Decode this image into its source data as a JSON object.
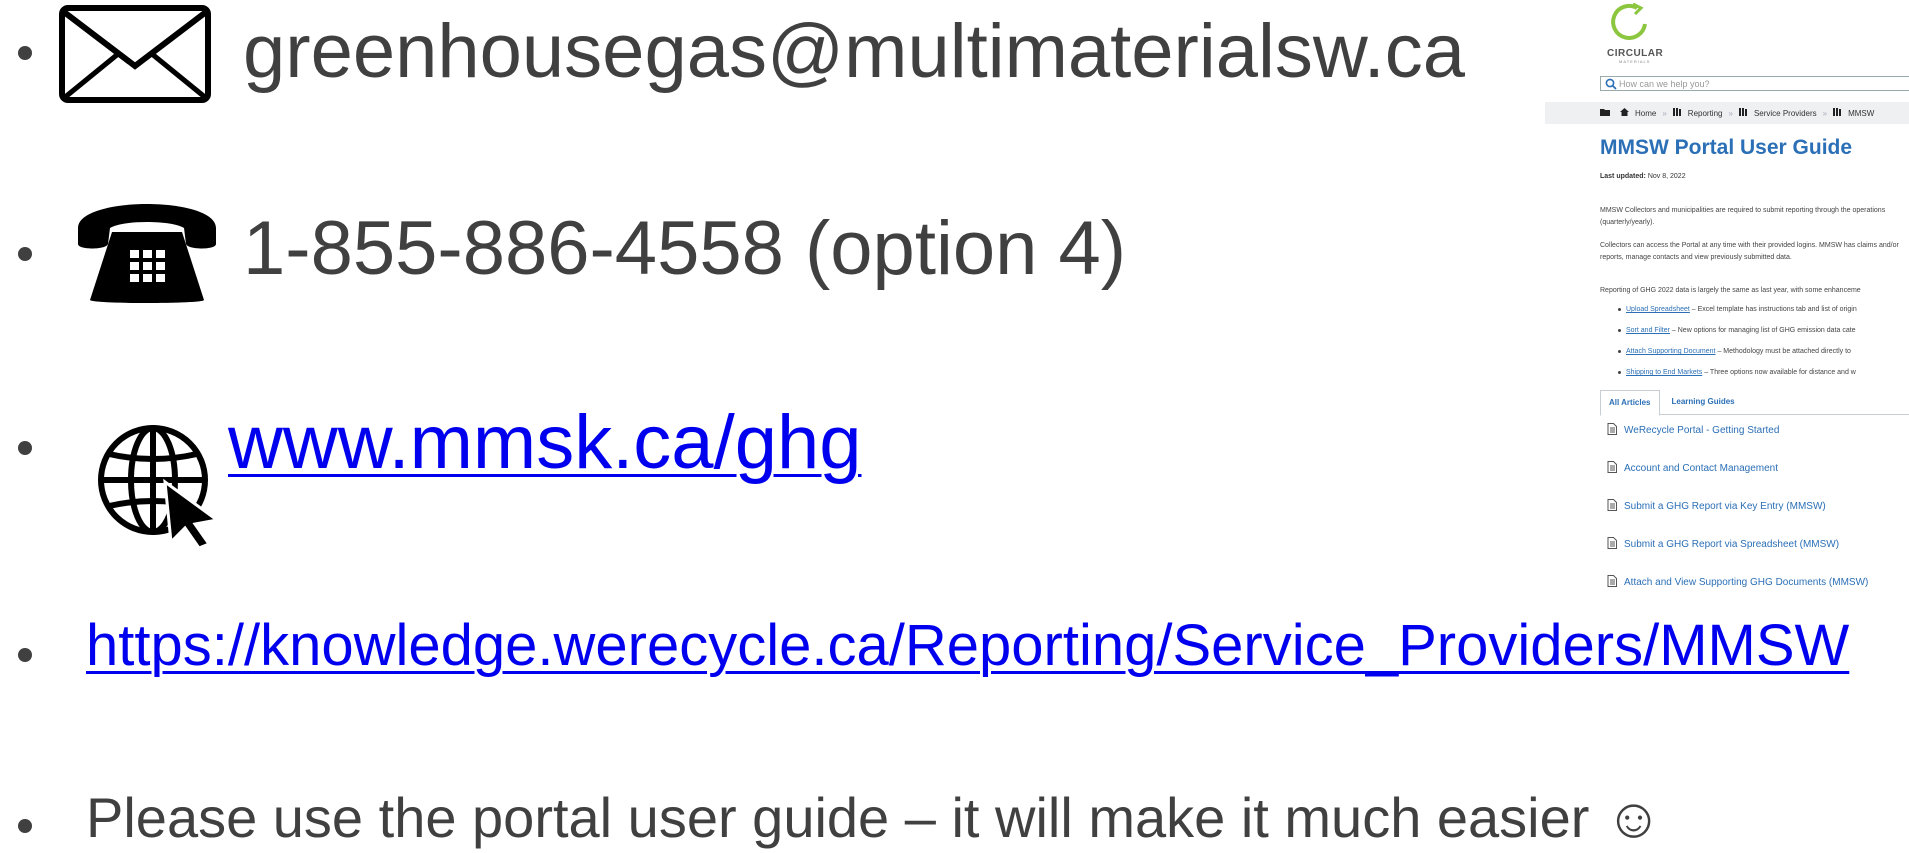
{
  "contacts": {
    "email": "greenhousegas@multimaterialsw.ca",
    "phone": "1-855-886-4558 (option 4)",
    "website": "www.mmsk.ca/ghg",
    "knowledge_url": "https://knowledge.werecycle.ca/Reporting/Service_Providers/MMSW",
    "note": "Please use the portal user guide – it will make it much easier ☺"
  },
  "icons": {
    "email": "envelope-icon",
    "phone": "telephone-icon",
    "web": "globe-cursor-icon"
  },
  "colors": {
    "text": "#404040",
    "link": "#0000ee",
    "portal_blue": "#2b6fb6"
  },
  "portal": {
    "brand": "CIRCULAR",
    "brand_sub": "MATERIALS",
    "search_placeholder": "How can we help you?",
    "breadcrumb": [
      "Home",
      "Reporting",
      "Service Providers",
      "MMSW"
    ],
    "title": "MMSW Portal User Guide",
    "updated_label": "Last updated:",
    "updated_date": "Nov 8, 2022",
    "para1": "MMSW Collectors and municipalities are required to submit reporting through the operations (quarterly/yearly).",
    "para2": "Collectors can access the Portal at any time with their provided logins. MMSW has claims and/or reports, manage contacts and view previously submitted data.",
    "para3": "Reporting of GHG 2022 data is largely the same as last year, with some enhanceme",
    "list": [
      {
        "link": "Upload Spreadsheet",
        "text": " – Excel template has instructions tab and list of origin"
      },
      {
        "link": "Sort and Filter",
        "text": " – New options for managing list of GHG emission data cate"
      },
      {
        "link": "Attach Supporting Document",
        "text": " – Methodology must be attached directly to"
      },
      {
        "link": "Shipping to End Markets",
        "text": " – Three options now available for distance and w"
      }
    ],
    "tabs": [
      "All Articles",
      "Learning Guides"
    ],
    "articles": [
      "WeRecycle Portal - Getting Started",
      "Account and Contact Management",
      "Submit a GHG Report via Key Entry (MMSW)",
      "Submit a GHG Report via Spreadsheet (MMSW)",
      "Attach and View Supporting GHG Documents (MMSW)"
    ]
  }
}
